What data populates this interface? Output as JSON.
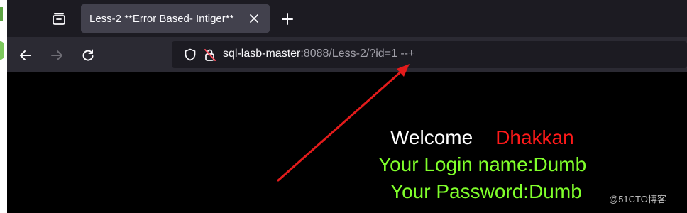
{
  "browser": {
    "tab": {
      "title": "Less-2 **Error Based- Intiger**"
    },
    "url": {
      "host": "sql-lasb-master",
      "rest": ":8088/Less-2/?id=1 --+"
    }
  },
  "page": {
    "welcome": "Welcome",
    "name": "Dhakkan",
    "login_line": "Your Login name:Dumb",
    "password_line": "Your Password:Dumb"
  },
  "watermark": "@51CTO博客",
  "colors": {
    "welcome": "#ffffff",
    "name": "#ff1a1a",
    "result": "#80ff2b",
    "annotation_arrow": "#e31b1b"
  },
  "icons": [
    "tab-overview-icon",
    "close-icon",
    "plus-icon",
    "back-arrow-icon",
    "forward-arrow-icon",
    "reload-icon",
    "shield-icon",
    "insecure-lock-icon"
  ]
}
